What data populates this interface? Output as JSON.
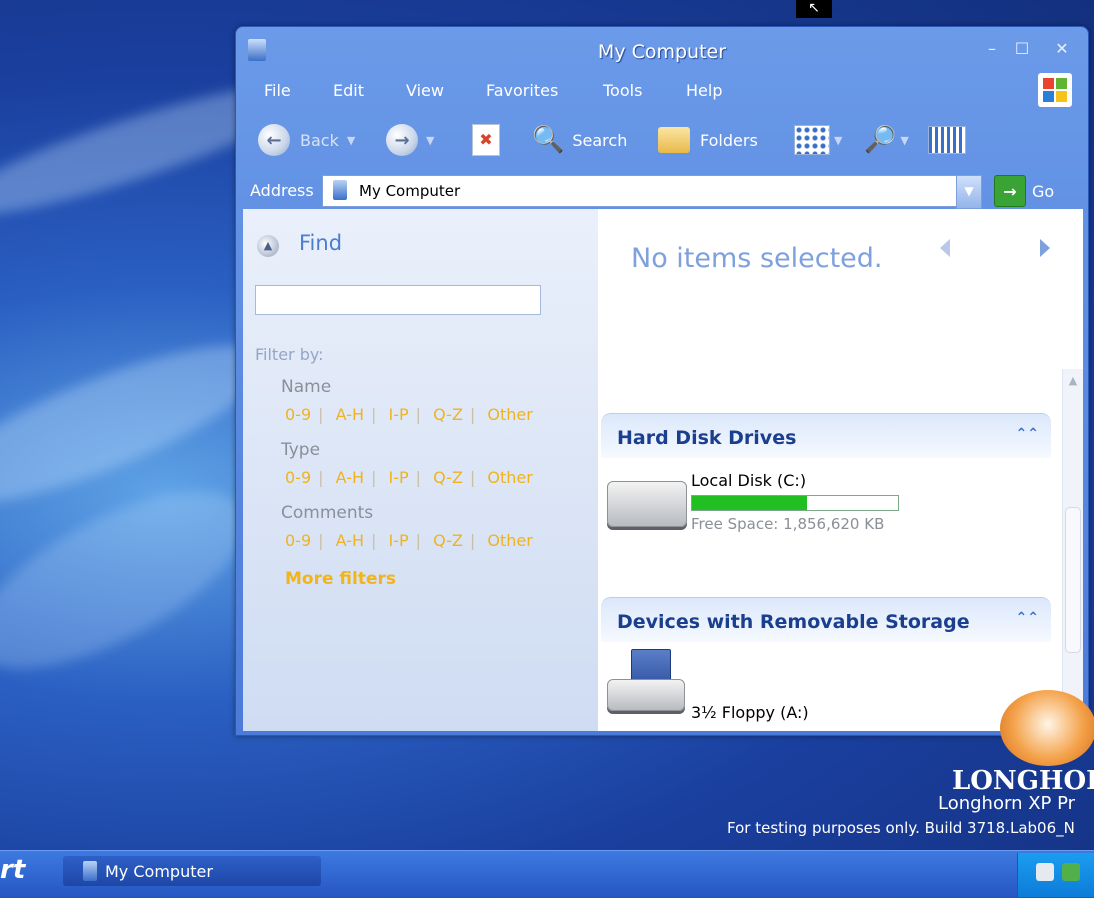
{
  "window": {
    "title": "My Computer",
    "menu": [
      "File",
      "Edit",
      "View",
      "Favorites",
      "Tools",
      "Help"
    ],
    "toolbar": {
      "back": "Back",
      "search": "Search",
      "folders": "Folders"
    },
    "address": {
      "label": "Address",
      "value": "My Computer",
      "go": "Go"
    }
  },
  "left_pane": {
    "find_title": "Find",
    "filter_label": "Filter by:",
    "groups": [
      {
        "label": "Name",
        "ranges": [
          "0-9",
          "A-H",
          "I-P",
          "Q-Z",
          "Other"
        ]
      },
      {
        "label": "Type",
        "ranges": [
          "0-9",
          "A-H",
          "I-P",
          "Q-Z",
          "Other"
        ]
      },
      {
        "label": "Comments",
        "ranges": [
          "0-9",
          "A-H",
          "I-P",
          "Q-Z",
          "Other"
        ]
      }
    ],
    "more_filters": "More filters"
  },
  "details": {
    "status": "No items selected."
  },
  "sections": {
    "hard_disks": {
      "title": "Hard Disk Drives",
      "drive_label": "Local Disk (C:)",
      "used_fraction": 0.56,
      "free_space": "Free Space: 1,856,620 KB"
    },
    "removable": {
      "title": "Devices with Removable Storage",
      "drive_label": "3½ Floppy (A:)"
    }
  },
  "desktop": {
    "watermark_title": "LONGHOR",
    "watermark_subtitle": "Longhorn XP Pr",
    "build_text": "For testing purposes only. Build 3718.Lab06_N"
  },
  "taskbar": {
    "start_fragment": "rt",
    "task_label": "My Computer"
  },
  "colors": {
    "accent": "#4b7bd8",
    "filter_link": "#f0b31f",
    "progress": "#21bf21"
  }
}
